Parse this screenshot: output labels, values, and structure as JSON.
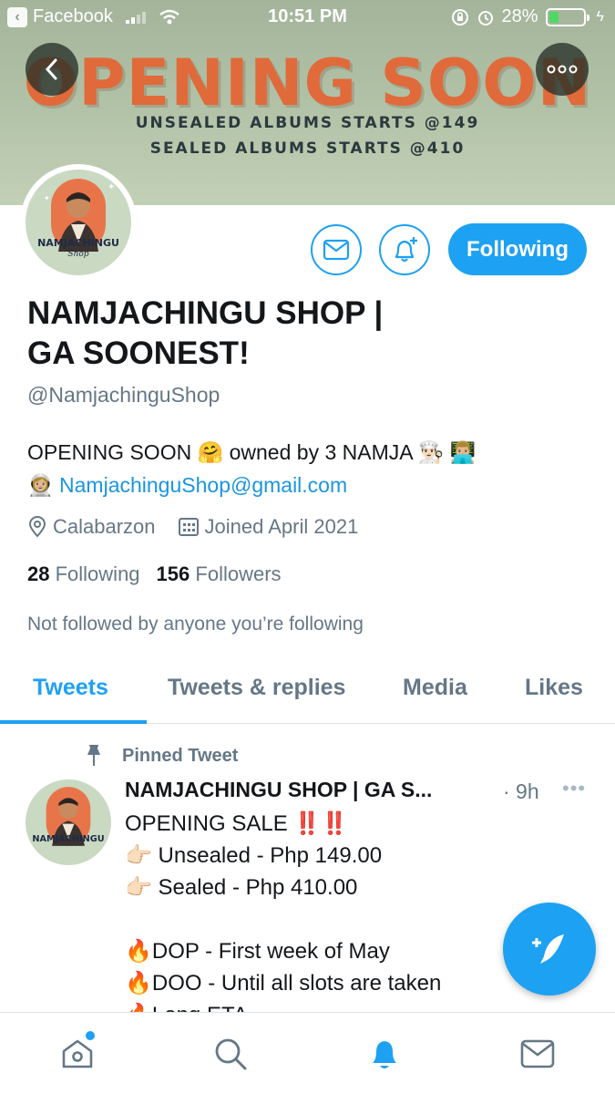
{
  "status_bar": {
    "back_app": "Facebook",
    "time": "10:51 PM",
    "battery": "28%",
    "battery_level": 0.28
  },
  "banner": {
    "title": "OPENING SOON",
    "line1": "UNSEALED ALBUMS STARTS @149",
    "line2": "SEALED ALBUMS STARTS @410"
  },
  "avatar": {
    "text": "NAMJACHINGU",
    "script": "Shop"
  },
  "actions": {
    "follow_label": "Following"
  },
  "profile": {
    "name_line1": "NAMJACHINGU SHOP |",
    "name_line2": "GA SOONEST!",
    "handle": "@NamjachinguShop",
    "bio_text1": "OPENING SOON 🤗 owned by 3 NAMJA 👨🏻‍🍳 👨🏼‍💻",
    "bio_emoji": "👩🏼‍🚀",
    "bio_email": "NamjachinguShop@gmail.com",
    "location": "Calabarzon",
    "joined": "Joined April 2021",
    "following_count": "28",
    "following_label": "Following",
    "followers_count": "156",
    "followers_label": "Followers",
    "not_followed": "Not followed by anyone you’re following"
  },
  "tabs": [
    "Tweets",
    "Tweets & replies",
    "Media",
    "Likes"
  ],
  "tweet": {
    "pinned_label": "Pinned Tweet",
    "author": "NAMJACHINGU SHOP | GA S...",
    "time": "· 9h",
    "more": "•••",
    "body": "OPENING SALE ‼️‼️\n👉🏻 Unsealed - Php 149.00\n👉🏻 Sealed - Php 410.00\n\n🔥DOP - First week of May\n🔥DOO - Until all slots are taken\n🔥Long ETA"
  },
  "colors": {
    "accent": "#1da1f2",
    "banner_title": "#e06a3a",
    "banner_bg": "#b3c3a8"
  }
}
